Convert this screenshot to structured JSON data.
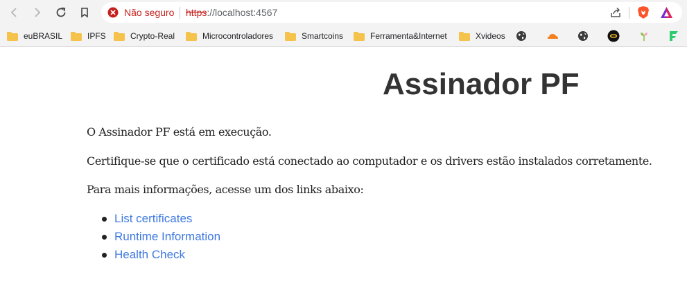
{
  "browser": {
    "security_label": "Não seguro",
    "url_scheme": "https",
    "url_rest": "://localhost:4567",
    "colors": {
      "insecure": "#c5221f",
      "toolbar": "#f3f3f3"
    }
  },
  "bookmarks": {
    "folders": [
      {
        "label": "euBRASIL"
      },
      {
        "label": "IPFS"
      },
      {
        "label": "Crypto-Real"
      },
      {
        "label": "Microcontroladores"
      },
      {
        "label": "Smartcoins"
      },
      {
        "label": "Ferramenta&Internet"
      },
      {
        "label": "Xvideos"
      }
    ],
    "icons": [
      "globe-icon",
      "cloudflare-icon",
      "globe-icon",
      "coinmarket-icon",
      "plant-icon",
      "flag-icon"
    ]
  },
  "page": {
    "title": "Assinador PF",
    "paragraphs": [
      "O Assinador PF está em execução.",
      "Certifique-se que o certificado está conectado ao computador e os drivers estão instalados corretamente.",
      "Para mais informações, acesse um dos links abaixo:"
    ],
    "links": [
      {
        "label": "List certificates"
      },
      {
        "label": "Runtime Information"
      },
      {
        "label": "Health Check"
      }
    ],
    "colors": {
      "link": "#3f79e0",
      "title": "#333333"
    }
  }
}
